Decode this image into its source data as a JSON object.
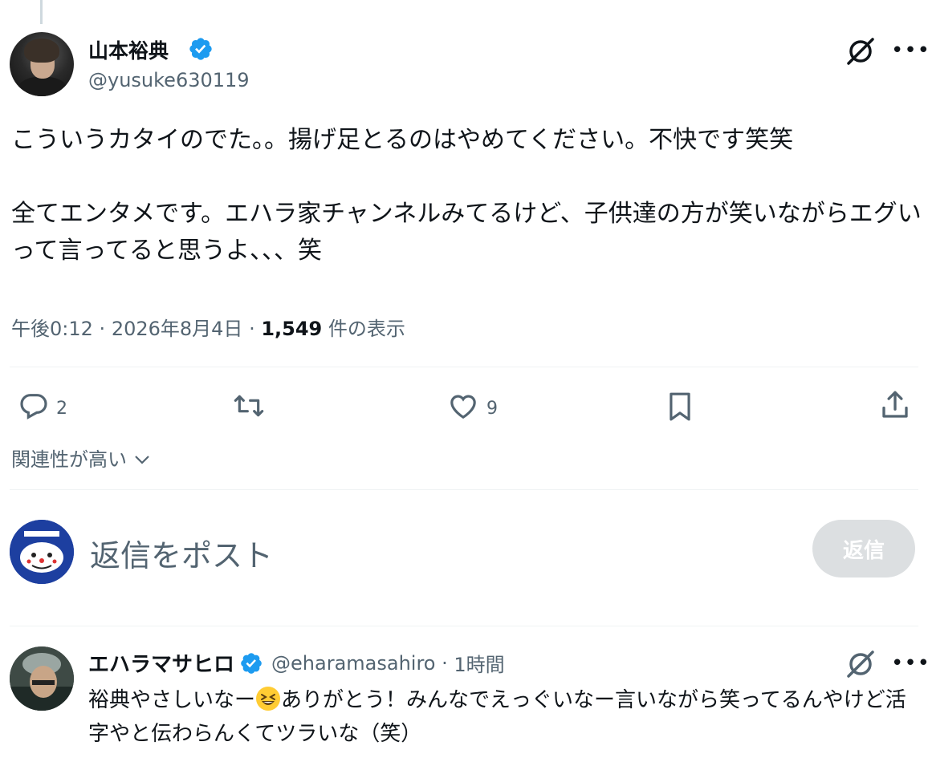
{
  "tweet": {
    "author_name": "山本裕典",
    "author_handle": "@yusuke630119",
    "paragraph1": "こういうカタイのでた。。揚げ足とるのはやめてください。不快です笑笑",
    "paragraph2": "全てエンタメです。エハラ家チャンネルみてるけど、子供達の方が笑いながらエグいって言ってると思うよ、、、笑",
    "time": "午後0:12",
    "date": "2026年8月4日",
    "views_count": "1,549",
    "views_label": "件の表示"
  },
  "actions": {
    "reply_count": "2",
    "like_count": "9"
  },
  "sort_label": "関連性が高い",
  "reply_box": {
    "placeholder": "返信をポスト",
    "button_label": "返信"
  },
  "comment": {
    "author_name": "エハラマサヒロ",
    "author_handle": "@eharamasahiro",
    "time": "1時間",
    "text_before_emoji": "裕典やさしいなー",
    "text_after_emoji": "ありがとう！みんなでえっぐいなー言いながら笑ってるんやけど活字やと伝わらんくてツラいな（笑）"
  },
  "colors": {
    "verified": "#1d9bf0",
    "secondary_text": "#536471",
    "reply_button_disabled": "#dcdfe1"
  },
  "icons": [
    "reply-icon",
    "retweet-icon",
    "like-icon",
    "bookmark-icon",
    "share-icon",
    "verified-icon",
    "grok-icon",
    "more-icon",
    "chevron-down-icon"
  ]
}
